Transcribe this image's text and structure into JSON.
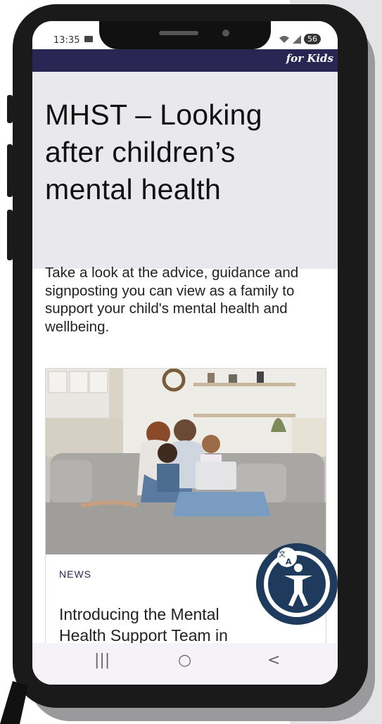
{
  "status_bar": {
    "time": "13:35",
    "battery_badge": "56"
  },
  "site_header": {
    "logo_text": "for Kids"
  },
  "hero": {
    "title": "MHST – Looking after children’s mental health"
  },
  "intro": {
    "text": "Take a look at the advice, guidance and signposting you can view as a family to support your child's mental health and wellbeing."
  },
  "card": {
    "image_alt": "family sitting on sofa with laptop",
    "tag": "NEWS",
    "title": "Introducing the Mental Health Support Team in"
  },
  "nav_bar": {
    "recent_icon": "|||",
    "home_icon": "○",
    "back_icon": "<"
  },
  "colors": {
    "header_bg": "#2a2654",
    "hero_bg": "#e9e8ec",
    "a11y_bg": "#1e3a5c"
  },
  "icons": [
    "message-icon",
    "wifi-icon",
    "signal-icon",
    "accessibility-icon",
    "translate-icon"
  ]
}
